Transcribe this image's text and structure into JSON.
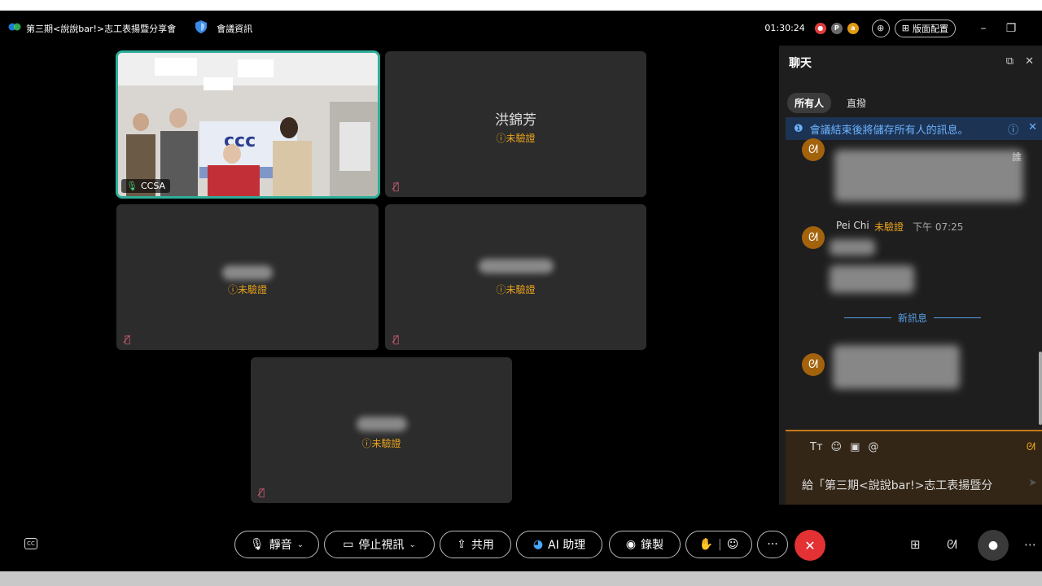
{
  "app": {
    "meeting_title": "第三期<說說bar!>志工表揚暨分享會",
    "meeting_info_label": "會議資訊",
    "timer": "01:30:24",
    "layout_label": "版面配置"
  },
  "tiles": [
    {
      "type": "video",
      "label": "CCSA",
      "video_text": "ccc"
    },
    {
      "type": "avatar",
      "name": "洪錦芳",
      "status": "未驗證"
    },
    {
      "type": "avatar",
      "name": "",
      "status": "未驗證"
    },
    {
      "type": "avatar",
      "name": "",
      "status": "未驗證"
    },
    {
      "type": "avatar",
      "name": "",
      "status": "未驗證"
    }
  ],
  "chat": {
    "title": "聊天",
    "tabs": [
      {
        "label": "所有人",
        "active": true
      },
      {
        "label": "直撥",
        "active": false
      }
    ],
    "banner": "會議結束後將儲存所有人的訊息。",
    "message": {
      "sender": "Pei Chi",
      "status": "未驗證",
      "time": "下午 07:25"
    },
    "truncated_char": "誰",
    "new_messages_label": "新訊息",
    "compose_placeholder": "給「第三期<說說bar!>志工表揚暨分"
  },
  "toolbar": {
    "mute_label": "靜音",
    "stop_video_label": "停止視訊",
    "share_label": "共用",
    "ai_label": "AI 助理",
    "record_label": "錄製",
    "more_label": "···"
  },
  "colors": {
    "accent_teal": "#2fae9a",
    "warning_orange": "#e7a21d",
    "end_red": "#e43134",
    "banner_blue": "#1d3353"
  }
}
